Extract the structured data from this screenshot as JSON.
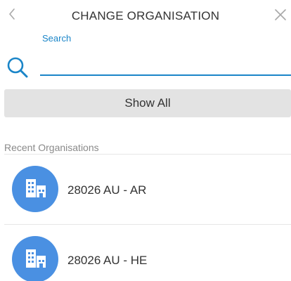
{
  "header": {
    "title": "CHANGE ORGANISATION",
    "back_icon": "chevron-left-icon",
    "close_icon": "close-icon"
  },
  "search": {
    "label": "Search",
    "value": "",
    "placeholder": "",
    "icon": "search-icon"
  },
  "show_all_label": "Show All",
  "recent": {
    "label": "Recent Organisations",
    "items": [
      {
        "name": "28026 AU - AR",
        "icon": "building-icon"
      },
      {
        "name": "28026 AU - HE",
        "icon": "building-icon"
      }
    ]
  },
  "colors": {
    "accent": "#1a85c8",
    "avatar": "#4a90e2",
    "button_bg": "#e3e3e3",
    "muted_text": "#8a8a8a"
  }
}
